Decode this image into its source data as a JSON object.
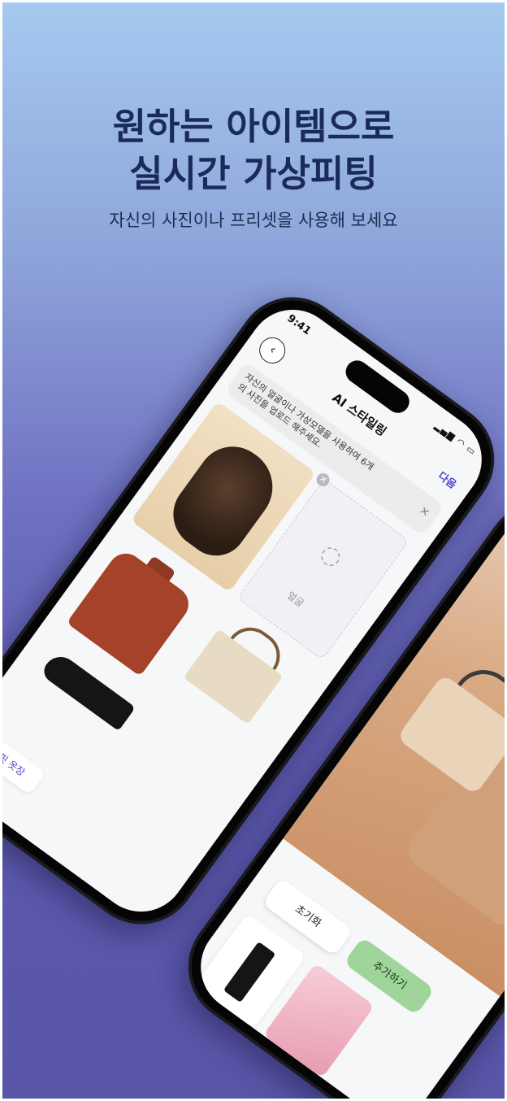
{
  "headline": {
    "line1": "원하는 아이템으로",
    "line2": "실시간 가상피팅"
  },
  "subline": "자신의 사진이나 프리셋을 사용해 보세요",
  "phone_left": {
    "status_time": "9:41",
    "title": "AI 스타일링",
    "next_label": "다음",
    "notice_line1": "자신의 얼굴이나 가상모델을 사용하여 6개",
    "notice_line2": "의 사진을 업로드 해주세요.",
    "face_label": "얼굴",
    "saved_outfit_label": "보고핏 옷장"
  },
  "phone_right": {
    "reset_label": "초기화",
    "add_label": "추가하기"
  },
  "colors": {
    "accent": "#4b47c8",
    "add_button": "#9fd59a"
  },
  "icons": [
    "back-chevron-icon",
    "close-icon",
    "face-outline-icon",
    "signal-icon",
    "wifi-icon",
    "battery-icon"
  ]
}
